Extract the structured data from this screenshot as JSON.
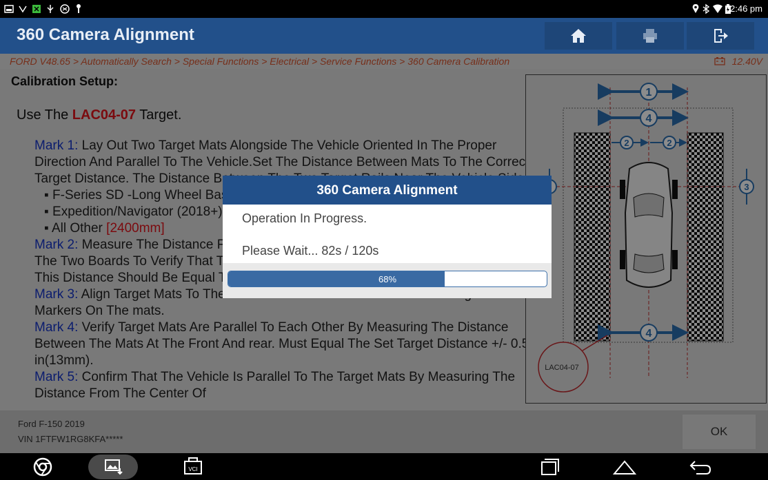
{
  "status_bar": {
    "time": "2:46 pm"
  },
  "header": {
    "title": "360 Camera Alignment",
    "buttons": [
      {
        "name": "home-button",
        "icon": "home-icon"
      },
      {
        "name": "print-button",
        "icon": "printer-icon"
      },
      {
        "name": "exit-button",
        "icon": "exit-icon"
      }
    ]
  },
  "breadcrumb": {
    "path": "FORD V48.65 > Automatically Search > Special Functions > Electrical > Service Functions > 360 Camera Calibration",
    "voltage": "12.40V"
  },
  "content": {
    "heading": "Calibration Setup:",
    "use_prefix": "Use The ",
    "use_target": "LAC04-07",
    "use_suffix": " Target.",
    "mark1_label": "Mark 1:",
    "mark1_text": " Lay Out Two Target Mats Alongside The Vehicle Oriented In The Proper Direction And Parallel To The Vehicle.Set The Distance Between Mats To The Correct Target Distance. The Distance Between The Two Target Rails Near The Vehicle Side.",
    "bullet1": "F-Series SD -Long Wheel Base",
    "bullet2": "Expedition/Navigator (2018+)",
    "bullet3_text": "All Other ",
    "bullet3_value": "[2400mm]",
    "mark2_label": "Mark 2:",
    "mark2_text": " Measure The Distance From The Center Of The Vehicle To The Edges Of The Two Boards To Verify That The Vehicle Is Centered Between The Two Boards. This Distance Should Be Equal To Half Of The Set target.",
    "mark3_label": "Mark 3:",
    "mark3_text": " Align Target Mats To The Center Of The Front wheels. Use The Alignment Markers On The mats.",
    "mark4_label": "Mark 4:",
    "mark4_text": " Verify Target Mats Are Parallel To Each Other By Measuring The Distance Between The Mats At The Front And rear. Must Equal The Set Target Distance +/- 0.5 in(13mm).",
    "mark5_label": "Mark 5:",
    "mark5_text": " Confirm That The Vehicle Is Parallel To The Target Mats By Measuring The Distance From The Center Of"
  },
  "diagram": {
    "target_label": "LAC04-07",
    "markers": [
      "1",
      "4",
      "2",
      "2",
      "3",
      "3",
      "4"
    ]
  },
  "footer": {
    "vehicle": "Ford F-150 2019",
    "vin": "VIN 1FTFW1RG8KFA*****",
    "ok_label": "OK"
  },
  "dialog": {
    "title": "360 Camera Alignment",
    "message": "Operation In Progress.",
    "wait": "Please Wait...  82s / 120s",
    "progress": 0.68,
    "progress_label": "68%"
  },
  "nav": {
    "icons": [
      "chrome-icon",
      "gallery-icon",
      "vci-icon",
      "recents-icon",
      "home-nav-icon",
      "back-icon"
    ],
    "vci_label": "VCI"
  },
  "colors": {
    "header_bg": "#22508a",
    "breadcrumb_text": "#d8552f",
    "mark_label": "#1636c8",
    "target_red": "#e0141c",
    "progress_fill": "#3a6aa3",
    "diagram_blue": "#2a6db0"
  }
}
